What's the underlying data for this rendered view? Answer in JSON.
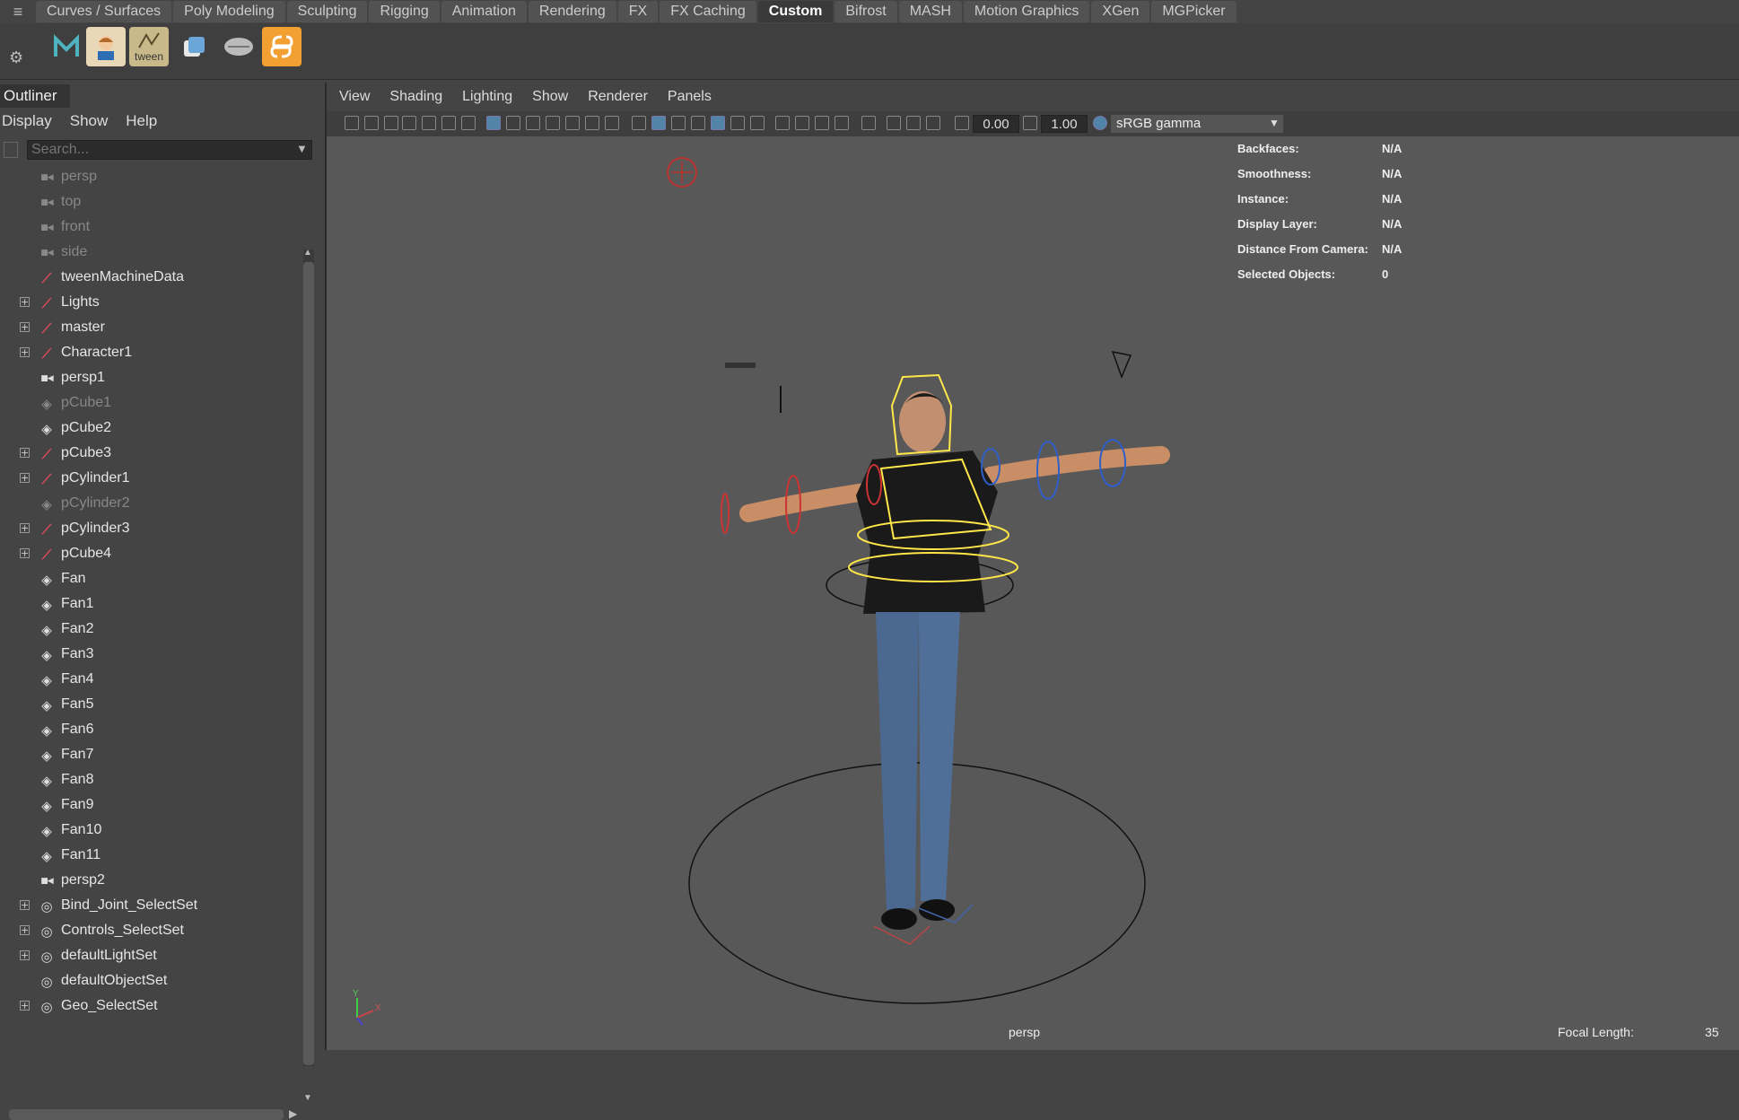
{
  "shelf": {
    "tabs": [
      {
        "label": "Curves / Surfaces"
      },
      {
        "label": "Poly Modeling"
      },
      {
        "label": "Sculpting"
      },
      {
        "label": "Rigging"
      },
      {
        "label": "Animation"
      },
      {
        "label": "Rendering"
      },
      {
        "label": "FX"
      },
      {
        "label": "FX Caching"
      },
      {
        "label": "Custom"
      },
      {
        "label": "Bifrost"
      },
      {
        "label": "MASH"
      },
      {
        "label": "Motion Graphics"
      },
      {
        "label": "XGen"
      },
      {
        "label": "MGPicker"
      }
    ],
    "active_tab": "Custom",
    "tween_label": "tween"
  },
  "outliner": {
    "title": "Outliner",
    "menu": [
      "Display",
      "Show",
      "Help"
    ],
    "search_placeholder": "Search...",
    "items": [
      {
        "label": "persp",
        "icon": "camera-icon",
        "dim": true,
        "expand": false
      },
      {
        "label": "top",
        "icon": "camera-icon",
        "dim": true,
        "expand": false
      },
      {
        "label": "front",
        "icon": "camera-icon",
        "dim": true,
        "expand": false
      },
      {
        "label": "side",
        "icon": "camera-icon",
        "dim": true,
        "expand": false
      },
      {
        "label": "tweenMachineData",
        "icon": "transform-icon",
        "dim": false,
        "expand": false
      },
      {
        "label": "Lights",
        "icon": "transform-icon",
        "dim": false,
        "expand": true
      },
      {
        "label": "master",
        "icon": "transform-icon",
        "dim": false,
        "expand": true
      },
      {
        "label": "Character1",
        "icon": "transform-icon",
        "dim": false,
        "expand": true
      },
      {
        "label": "persp1",
        "icon": "camera-icon",
        "dim": false,
        "expand": false
      },
      {
        "label": "pCube1",
        "icon": "mesh-icon",
        "dim": true,
        "expand": false
      },
      {
        "label": "pCube2",
        "icon": "mesh-icon",
        "dim": false,
        "expand": false
      },
      {
        "label": "pCube3",
        "icon": "transform-icon",
        "dim": false,
        "expand": true
      },
      {
        "label": "pCylinder1",
        "icon": "transform-icon",
        "dim": false,
        "expand": true
      },
      {
        "label": "pCylinder2",
        "icon": "mesh-icon",
        "dim": true,
        "expand": false
      },
      {
        "label": "pCylinder3",
        "icon": "transform-icon",
        "dim": false,
        "expand": true
      },
      {
        "label": "pCube4",
        "icon": "transform-icon",
        "dim": false,
        "expand": true
      },
      {
        "label": "Fan",
        "icon": "mesh-icon",
        "dim": false,
        "expand": false
      },
      {
        "label": "Fan1",
        "icon": "mesh-icon",
        "dim": false,
        "expand": false
      },
      {
        "label": "Fan2",
        "icon": "mesh-icon",
        "dim": false,
        "expand": false
      },
      {
        "label": "Fan3",
        "icon": "mesh-icon",
        "dim": false,
        "expand": false
      },
      {
        "label": "Fan4",
        "icon": "mesh-icon",
        "dim": false,
        "expand": false
      },
      {
        "label": "Fan5",
        "icon": "mesh-icon",
        "dim": false,
        "expand": false
      },
      {
        "label": "Fan6",
        "icon": "mesh-icon",
        "dim": false,
        "expand": false
      },
      {
        "label": "Fan7",
        "icon": "mesh-icon",
        "dim": false,
        "expand": false
      },
      {
        "label": "Fan8",
        "icon": "mesh-icon",
        "dim": false,
        "expand": false
      },
      {
        "label": "Fan9",
        "icon": "mesh-icon",
        "dim": false,
        "expand": false
      },
      {
        "label": "Fan10",
        "icon": "mesh-icon",
        "dim": false,
        "expand": false
      },
      {
        "label": "Fan11",
        "icon": "mesh-icon",
        "dim": false,
        "expand": false
      },
      {
        "label": "persp2",
        "icon": "camera-icon",
        "dim": false,
        "expand": false
      },
      {
        "label": "Bind_Joint_SelectSet",
        "icon": "set-icon",
        "dim": false,
        "expand": true
      },
      {
        "label": "Controls_SelectSet",
        "icon": "set-icon",
        "dim": false,
        "expand": true
      },
      {
        "label": "defaultLightSet",
        "icon": "set-icon",
        "dim": false,
        "expand": true
      },
      {
        "label": "defaultObjectSet",
        "icon": "set-icon",
        "dim": false,
        "expand": false
      },
      {
        "label": "Geo_SelectSet",
        "icon": "set-icon",
        "dim": false,
        "expand": true
      }
    ]
  },
  "panel": {
    "menu": [
      "View",
      "Shading",
      "Lighting",
      "Show",
      "Renderer",
      "Panels"
    ],
    "exposure": "0.00",
    "gamma": "1.00",
    "color_space": "sRGB gamma"
  },
  "hud": {
    "rows": [
      {
        "label": "Backfaces:",
        "value": "N/A"
      },
      {
        "label": "Smoothness:",
        "value": "N/A"
      },
      {
        "label": "Instance:",
        "value": "N/A"
      },
      {
        "label": "Display Layer:",
        "value": "N/A"
      },
      {
        "label": "Distance From Camera:",
        "value": "N/A"
      },
      {
        "label": "Selected Objects:",
        "value": "0"
      }
    ],
    "camera": "persp",
    "focal_label": "Focal Length:",
    "focal_value": "35",
    "axis_y": "Y",
    "axis_x": "X"
  }
}
